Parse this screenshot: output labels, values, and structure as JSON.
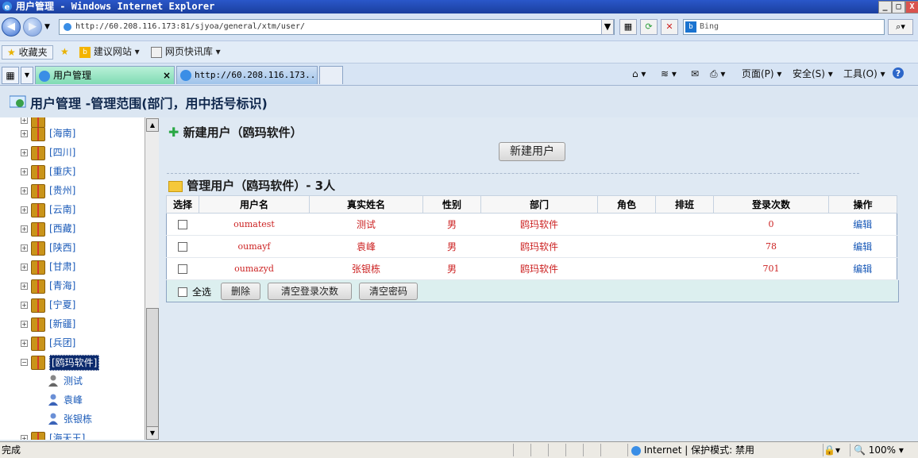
{
  "window": {
    "title": "用户管理 - Windows Internet Explorer",
    "minimize": "_",
    "maximize": "□",
    "close": "X"
  },
  "address": {
    "url": "http://60.208.116.173:81/sjyoa/general/xtm/user/",
    "search_placeholder": "Bing"
  },
  "favorites": {
    "label": "收藏夹",
    "items": [
      "建议网站 ▾",
      "网页快讯库 ▾"
    ]
  },
  "tabs": [
    {
      "label": "用户管理",
      "close": "×"
    },
    {
      "label": "http://60.208.116.173..."
    }
  ],
  "commandbar": {
    "page": "页面(P) ▾",
    "safety": "安全(S) ▾",
    "tools": "工具(O) ▾",
    "help": "?"
  },
  "page_header": "用户管理 -管理范围(部门，用中括号标识)",
  "tree": {
    "nodes": [
      "[海南]",
      "[四川]",
      "[重庆]",
      "[贵州]",
      "[云南]",
      "[西藏]",
      "[陕西]",
      "[甘肃]",
      "[青海]",
      "[宁夏]",
      "[新疆]",
      "[兵团]",
      "[鸥玛软件]"
    ],
    "selected": "[鸥玛软件]",
    "leaves": [
      "测试",
      "袁峰",
      "张银栋"
    ],
    "partial_bottom": "[海天王]"
  },
  "main": {
    "new_section_title": "新建用户（鸥玛软件）",
    "new_button": "新建用户",
    "manage_section_title": "管理用户（鸥玛软件）- 3人",
    "columns": [
      "选择",
      "用户名",
      "真实姓名",
      "性别",
      "部门",
      "角色",
      "排班",
      "登录次数",
      "操作"
    ],
    "rows": [
      {
        "username": "oumatest",
        "realname": "测试",
        "gender": "男",
        "dept": "鸥玛软件",
        "role": "",
        "shift": "",
        "logins": "0",
        "action": "编辑"
      },
      {
        "username": "oumayf",
        "realname": "袁峰",
        "gender": "男",
        "dept": "鸥玛软件",
        "role": "",
        "shift": "",
        "logins": "78",
        "action": "编辑"
      },
      {
        "username": "oumazyd",
        "realname": "张银栋",
        "gender": "男",
        "dept": "鸥玛软件",
        "role": "",
        "shift": "",
        "logins": "701",
        "action": "编辑"
      }
    ],
    "select_all": "全选",
    "buttons": {
      "delete": "删除",
      "clear_logins": "清空登录次数",
      "clear_password": "清空密码"
    }
  },
  "status": {
    "text": "完成",
    "zone": "Internet | 保护模式: 禁用",
    "zoom": "100%"
  },
  "colors": {
    "accent": "#1a5ab8",
    "data_red": "#cc2222",
    "header_bg": "#dbe6f2"
  }
}
